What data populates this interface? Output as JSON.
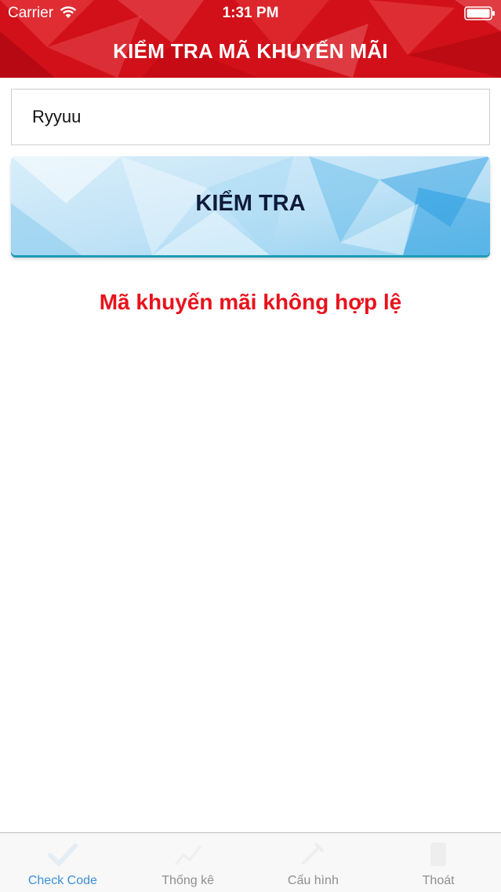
{
  "status_bar": {
    "carrier": "Carrier",
    "time": "1:31 PM",
    "wifi_icon": "wifi-icon",
    "battery_icon": "battery-icon"
  },
  "header": {
    "title": "KIỂM TRA MÃ KHUYẾN MÃI"
  },
  "code_input": {
    "value": "Ryyuu"
  },
  "check_button": {
    "label": "KIỂM TRA"
  },
  "result": {
    "message": "Mã khuyến mãi không hợp lệ"
  },
  "tabs": [
    {
      "label": "Check Code",
      "icon": "checkmark-icon",
      "active": true
    },
    {
      "label": "Thống kê",
      "icon": "statistics-icon",
      "active": false
    },
    {
      "label": "Cấu hình",
      "icon": "settings-icon",
      "active": false
    },
    {
      "label": "Thoát",
      "icon": "logout-icon",
      "active": false
    }
  ],
  "colors": {
    "header_red": "#d4101a",
    "error_red": "#e8121c",
    "button_text": "#0f1b3a",
    "tab_active": "#3c8fd8",
    "tab_inactive": "#8e8e93"
  }
}
